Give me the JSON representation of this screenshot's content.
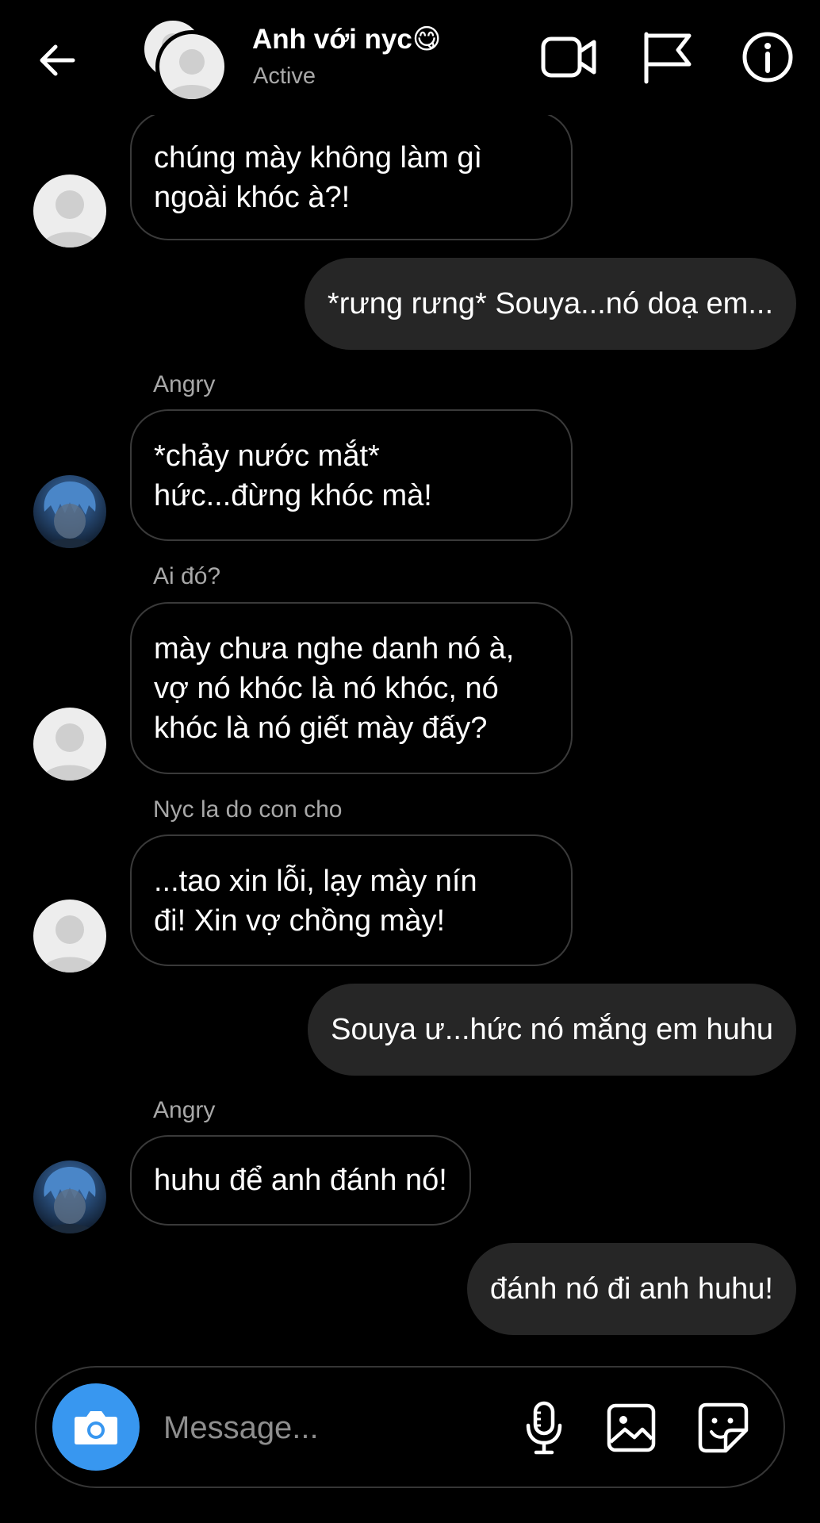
{
  "header": {
    "back_icon": "arrow-left-icon",
    "title": "Anh với nyc😋",
    "status": "Active",
    "icons": [
      "video-call-icon",
      "flag-icon",
      "info-icon"
    ]
  },
  "messages": [
    {
      "direction": "in",
      "sender": "",
      "text": "chúng mày không làm gì\nngoài khóc à?!",
      "avatar": "default"
    },
    {
      "direction": "out",
      "text": "*rưng rưng* Souya...nó doạ em..."
    },
    {
      "direction": "in",
      "sender": "Angry",
      "text": "*chảy nước mắt*\nhức...đừng khóc mà!",
      "avatar": "anime"
    },
    {
      "direction": "in",
      "sender": "Ai đó?",
      "text": "mày chưa nghe danh nó à,\nvợ nó khóc là nó khóc, nó\nkhóc là nó giết mày đấy?",
      "avatar": "default"
    },
    {
      "direction": "in",
      "sender": "Nyc la do con cho",
      "text": "...tao xin lỗi, lạy mày nín\nđi! Xin vợ chồng mày!",
      "avatar": "default"
    },
    {
      "direction": "out",
      "text": "Souya ư...hức nó mắng em huhu"
    },
    {
      "direction": "in",
      "sender": "Angry",
      "text": "huhu để anh đánh nó!",
      "avatar": "anime"
    },
    {
      "direction": "out",
      "text": "đánh nó đi anh huhu!"
    }
  ],
  "composer": {
    "placeholder": "Message...",
    "camera_icon": "camera-icon",
    "icons": [
      "microphone-icon",
      "gallery-icon",
      "sticker-icon"
    ],
    "accent_color": "#3897f0"
  }
}
